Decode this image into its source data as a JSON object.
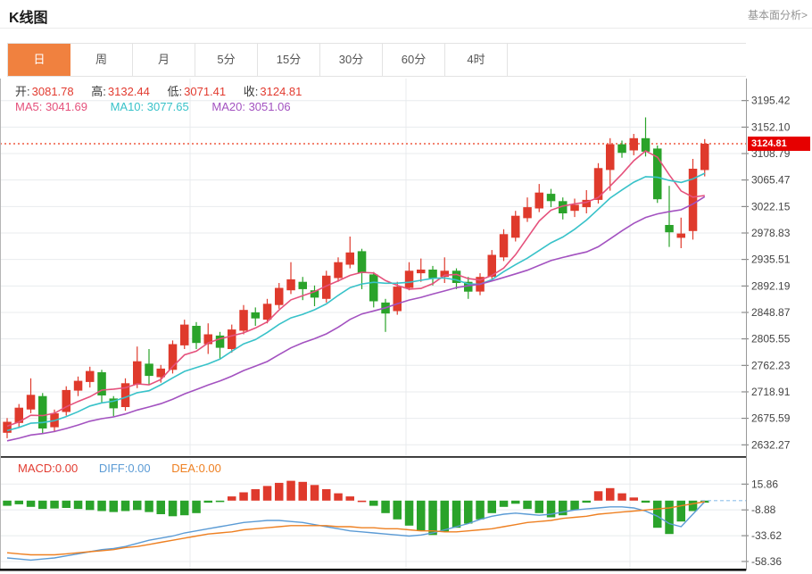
{
  "header": {
    "title": "K线图",
    "link": "基本面分析>"
  },
  "tabs": {
    "items": [
      "日",
      "周",
      "月",
      "5分",
      "15分",
      "30分",
      "60分",
      "4时"
    ],
    "selected_index": 0
  },
  "ohlc": {
    "open_label": "开:",
    "open": "3081.78",
    "high_label": "高:",
    "high": "3132.44",
    "low_label": "低:",
    "low": "3071.41",
    "close_label": "收:",
    "close": "3124.81"
  },
  "ma_legend": {
    "ma5": "MA5: 3041.69",
    "ma10": "MA10: 3077.65",
    "ma20": "MA20: 3051.06"
  },
  "macd_legend": {
    "macd": "MACD:0.00",
    "diff": "DIFF:0.00",
    "dea": "DEA:0.00"
  },
  "price_marker": {
    "value": "3124.81"
  },
  "colors": {
    "up": "#df3a2c",
    "down": "#2aa32a",
    "ma5": "#e5517c",
    "ma10": "#38c2c9",
    "ma20": "#a352c0",
    "accent_orange": "#f0813f",
    "value_red": "#e23b30",
    "badge_bg": "#e60000",
    "price_line": "#ef5a40",
    "diff_blue": "#5b9bd5",
    "dea_orange": "#ee8022",
    "grid": "#e8ebee",
    "axis": "#999999",
    "tick": "#777777",
    "label": "#444444",
    "zero_dash": "#8fc1ea"
  },
  "chart_data": {
    "type": "candlestick+macd",
    "title": "K线图 daily candles with MA5/MA10/MA20 and MACD",
    "main": {
      "y_ticks": [
        "3195.42",
        "3152.10",
        "3108.79",
        "3065.47",
        "3022.15",
        "2978.83",
        "2935.51",
        "2892.19",
        "2848.87",
        "2805.55",
        "2762.23",
        "2718.91",
        "2675.59",
        "2632.27"
      ],
      "price_line": 3124.81,
      "candles_format": "[open, close, low, high]",
      "candles": [
        [
          2652,
          2670,
          2643,
          2676
        ],
        [
          2668,
          2693,
          2661,
          2699
        ],
        [
          2690,
          2714,
          2684,
          2741
        ],
        [
          2712,
          2659,
          2650,
          2717
        ],
        [
          2661,
          2684,
          2653,
          2690
        ],
        [
          2686,
          2722,
          2680,
          2728
        ],
        [
          2721,
          2737,
          2712,
          2744
        ],
        [
          2735,
          2753,
          2726,
          2760
        ],
        [
          2751,
          2713,
          2701,
          2755
        ],
        [
          2708,
          2692,
          2679,
          2712
        ],
        [
          2694,
          2733,
          2688,
          2741
        ],
        [
          2731,
          2769,
          2725,
          2793
        ],
        [
          2765,
          2745,
          2731,
          2789
        ],
        [
          2743,
          2757,
          2734,
          2763
        ],
        [
          2755,
          2797,
          2749,
          2803
        ],
        [
          2795,
          2829,
          2789,
          2837
        ],
        [
          2827,
          2799,
          2789,
          2833
        ],
        [
          2797,
          2813,
          2781,
          2831
        ],
        [
          2811,
          2791,
          2773,
          2817
        ],
        [
          2789,
          2821,
          2783,
          2829
        ],
        [
          2819,
          2853,
          2813,
          2861
        ],
        [
          2849,
          2839,
          2827,
          2857
        ],
        [
          2837,
          2863,
          2831,
          2871
        ],
        [
          2861,
          2889,
          2855,
          2897
        ],
        [
          2885,
          2903,
          2879,
          2931
        ],
        [
          2899,
          2887,
          2869,
          2907
        ],
        [
          2885,
          2873,
          2859,
          2893
        ],
        [
          2871,
          2909,
          2865,
          2917
        ],
        [
          2905,
          2931,
          2899,
          2939
        ],
        [
          2927,
          2947,
          2921,
          2973
        ],
        [
          2949,
          2913,
          2887,
          2953
        ],
        [
          2911,
          2867,
          2857,
          2915
        ],
        [
          2865,
          2847,
          2817,
          2871
        ],
        [
          2851,
          2891,
          2845,
          2899
        ],
        [
          2889,
          2917,
          2885,
          2931
        ],
        [
          2913,
          2919,
          2899,
          2937
        ],
        [
          2919,
          2905,
          2893,
          2925
        ],
        [
          2907,
          2917,
          2897,
          2939
        ],
        [
          2917,
          2897,
          2887,
          2921
        ],
        [
          2899,
          2883,
          2871,
          2907
        ],
        [
          2883,
          2907,
          2877,
          2913
        ],
        [
          2907,
          2943,
          2901,
          2951
        ],
        [
          2939,
          2977,
          2933,
          2985
        ],
        [
          2971,
          3007,
          2965,
          3015
        ],
        [
          3003,
          3021,
          2997,
          3037
        ],
        [
          3019,
          3045,
          3013,
          3059
        ],
        [
          3043,
          3031,
          3021,
          3051
        ],
        [
          3031,
          3011,
          3001,
          3037
        ],
        [
          3015,
          3025,
          3005,
          3035
        ],
        [
          3021,
          3033,
          3011,
          3049
        ],
        [
          3033,
          3085,
          3027,
          3093
        ],
        [
          3082,
          3124,
          3048,
          3134
        ],
        [
          3124,
          3110,
          3102,
          3130
        ],
        [
          3114,
          3134,
          3106,
          3141
        ],
        [
          3134,
          3112,
          3104,
          3168
        ],
        [
          3117,
          3034,
          3028,
          3122
        ],
        [
          2992,
          2980,
          2956,
          3056
        ],
        [
          2971,
          2978,
          2954,
          3004
        ],
        [
          2982,
          3084,
          2968,
          3100
        ],
        [
          3081.78,
          3124.81,
          3071.41,
          3132.44
        ]
      ],
      "ma_prehistory": [
        2604,
        2607,
        2610,
        2613,
        2617,
        2620,
        2624,
        2627,
        2631,
        2634,
        2638,
        2641,
        2645,
        2648,
        2652,
        2655,
        2658,
        2660,
        2662,
        2664
      ]
    },
    "macd": {
      "y_ticks": [
        "15.86",
        "-8.88",
        "-33.62",
        "-58.36"
      ],
      "hist_format": "[value, color r|g]",
      "hist": [
        [
          -5,
          "g"
        ],
        [
          -3.5,
          "g"
        ],
        [
          -6,
          "g"
        ],
        [
          -8,
          "g"
        ],
        [
          -7.5,
          "g"
        ],
        [
          -7,
          "g"
        ],
        [
          -8,
          "g"
        ],
        [
          -9,
          "g"
        ],
        [
          -10,
          "g"
        ],
        [
          -11,
          "g"
        ],
        [
          -10,
          "g"
        ],
        [
          -9,
          "g"
        ],
        [
          -11,
          "g"
        ],
        [
          -13,
          "g"
        ],
        [
          -15,
          "g"
        ],
        [
          -14,
          "g"
        ],
        [
          -12,
          "g"
        ],
        [
          -2,
          "g"
        ],
        [
          -1,
          "g"
        ],
        [
          4,
          "r"
        ],
        [
          8,
          "r"
        ],
        [
          11,
          "r"
        ],
        [
          14,
          "r"
        ],
        [
          17,
          "r"
        ],
        [
          19,
          "r"
        ],
        [
          18,
          "r"
        ],
        [
          15,
          "r"
        ],
        [
          11,
          "r"
        ],
        [
          7,
          "r"
        ],
        [
          4,
          "r"
        ],
        [
          -1,
          "r"
        ],
        [
          -5,
          "g"
        ],
        [
          -12,
          "g"
        ],
        [
          -18,
          "g"
        ],
        [
          -24,
          "g"
        ],
        [
          -29,
          "g"
        ],
        [
          -33,
          "g"
        ],
        [
          -30,
          "g"
        ],
        [
          -26,
          "g"
        ],
        [
          -22,
          "g"
        ],
        [
          -18,
          "g"
        ],
        [
          -12,
          "g"
        ],
        [
          -6,
          "g"
        ],
        [
          -3,
          "g"
        ],
        [
          -8,
          "g"
        ],
        [
          -12,
          "g"
        ],
        [
          -16,
          "g"
        ],
        [
          -14,
          "g"
        ],
        [
          -9,
          "g"
        ],
        [
          -2,
          "g"
        ],
        [
          9,
          "r"
        ],
        [
          12,
          "r"
        ],
        [
          7,
          "r"
        ],
        [
          3,
          "r"
        ],
        [
          -2,
          "g"
        ],
        [
          -26,
          "g"
        ],
        [
          -32,
          "g"
        ],
        [
          -20,
          "g"
        ],
        [
          -10,
          "g"
        ],
        [
          -2,
          "g"
        ]
      ],
      "diff": [
        -55,
        -56,
        -57,
        -56,
        -55,
        -53,
        -51,
        -49,
        -47,
        -46,
        -44,
        -41,
        -38,
        -36,
        -34,
        -31,
        -29,
        -27,
        -25,
        -23,
        -21,
        -20,
        -19,
        -19,
        -20,
        -21,
        -23,
        -25,
        -27,
        -29,
        -30,
        -31,
        -32,
        -33,
        -34,
        -33,
        -31,
        -28,
        -25,
        -22,
        -18,
        -15,
        -13,
        -12,
        -13,
        -14,
        -13,
        -11,
        -9,
        -8,
        -7,
        -6,
        -6,
        -7,
        -10,
        -15,
        -22,
        -25,
        -13,
        -1
      ],
      "dea": [
        -50,
        -51,
        -52,
        -52,
        -52,
        -51,
        -50,
        -49,
        -48,
        -47,
        -45,
        -44,
        -42,
        -40,
        -38,
        -36,
        -34,
        -32,
        -31,
        -30,
        -28,
        -27,
        -26,
        -25,
        -24,
        -24,
        -24,
        -24,
        -25,
        -25,
        -26,
        -26,
        -27,
        -27,
        -28,
        -29,
        -29,
        -30,
        -30,
        -29,
        -28,
        -27,
        -25,
        -23,
        -21,
        -20,
        -19,
        -17,
        -16,
        -15,
        -13,
        -12,
        -11,
        -10,
        -9,
        -8,
        -7,
        -5,
        -3,
        -1
      ]
    }
  }
}
